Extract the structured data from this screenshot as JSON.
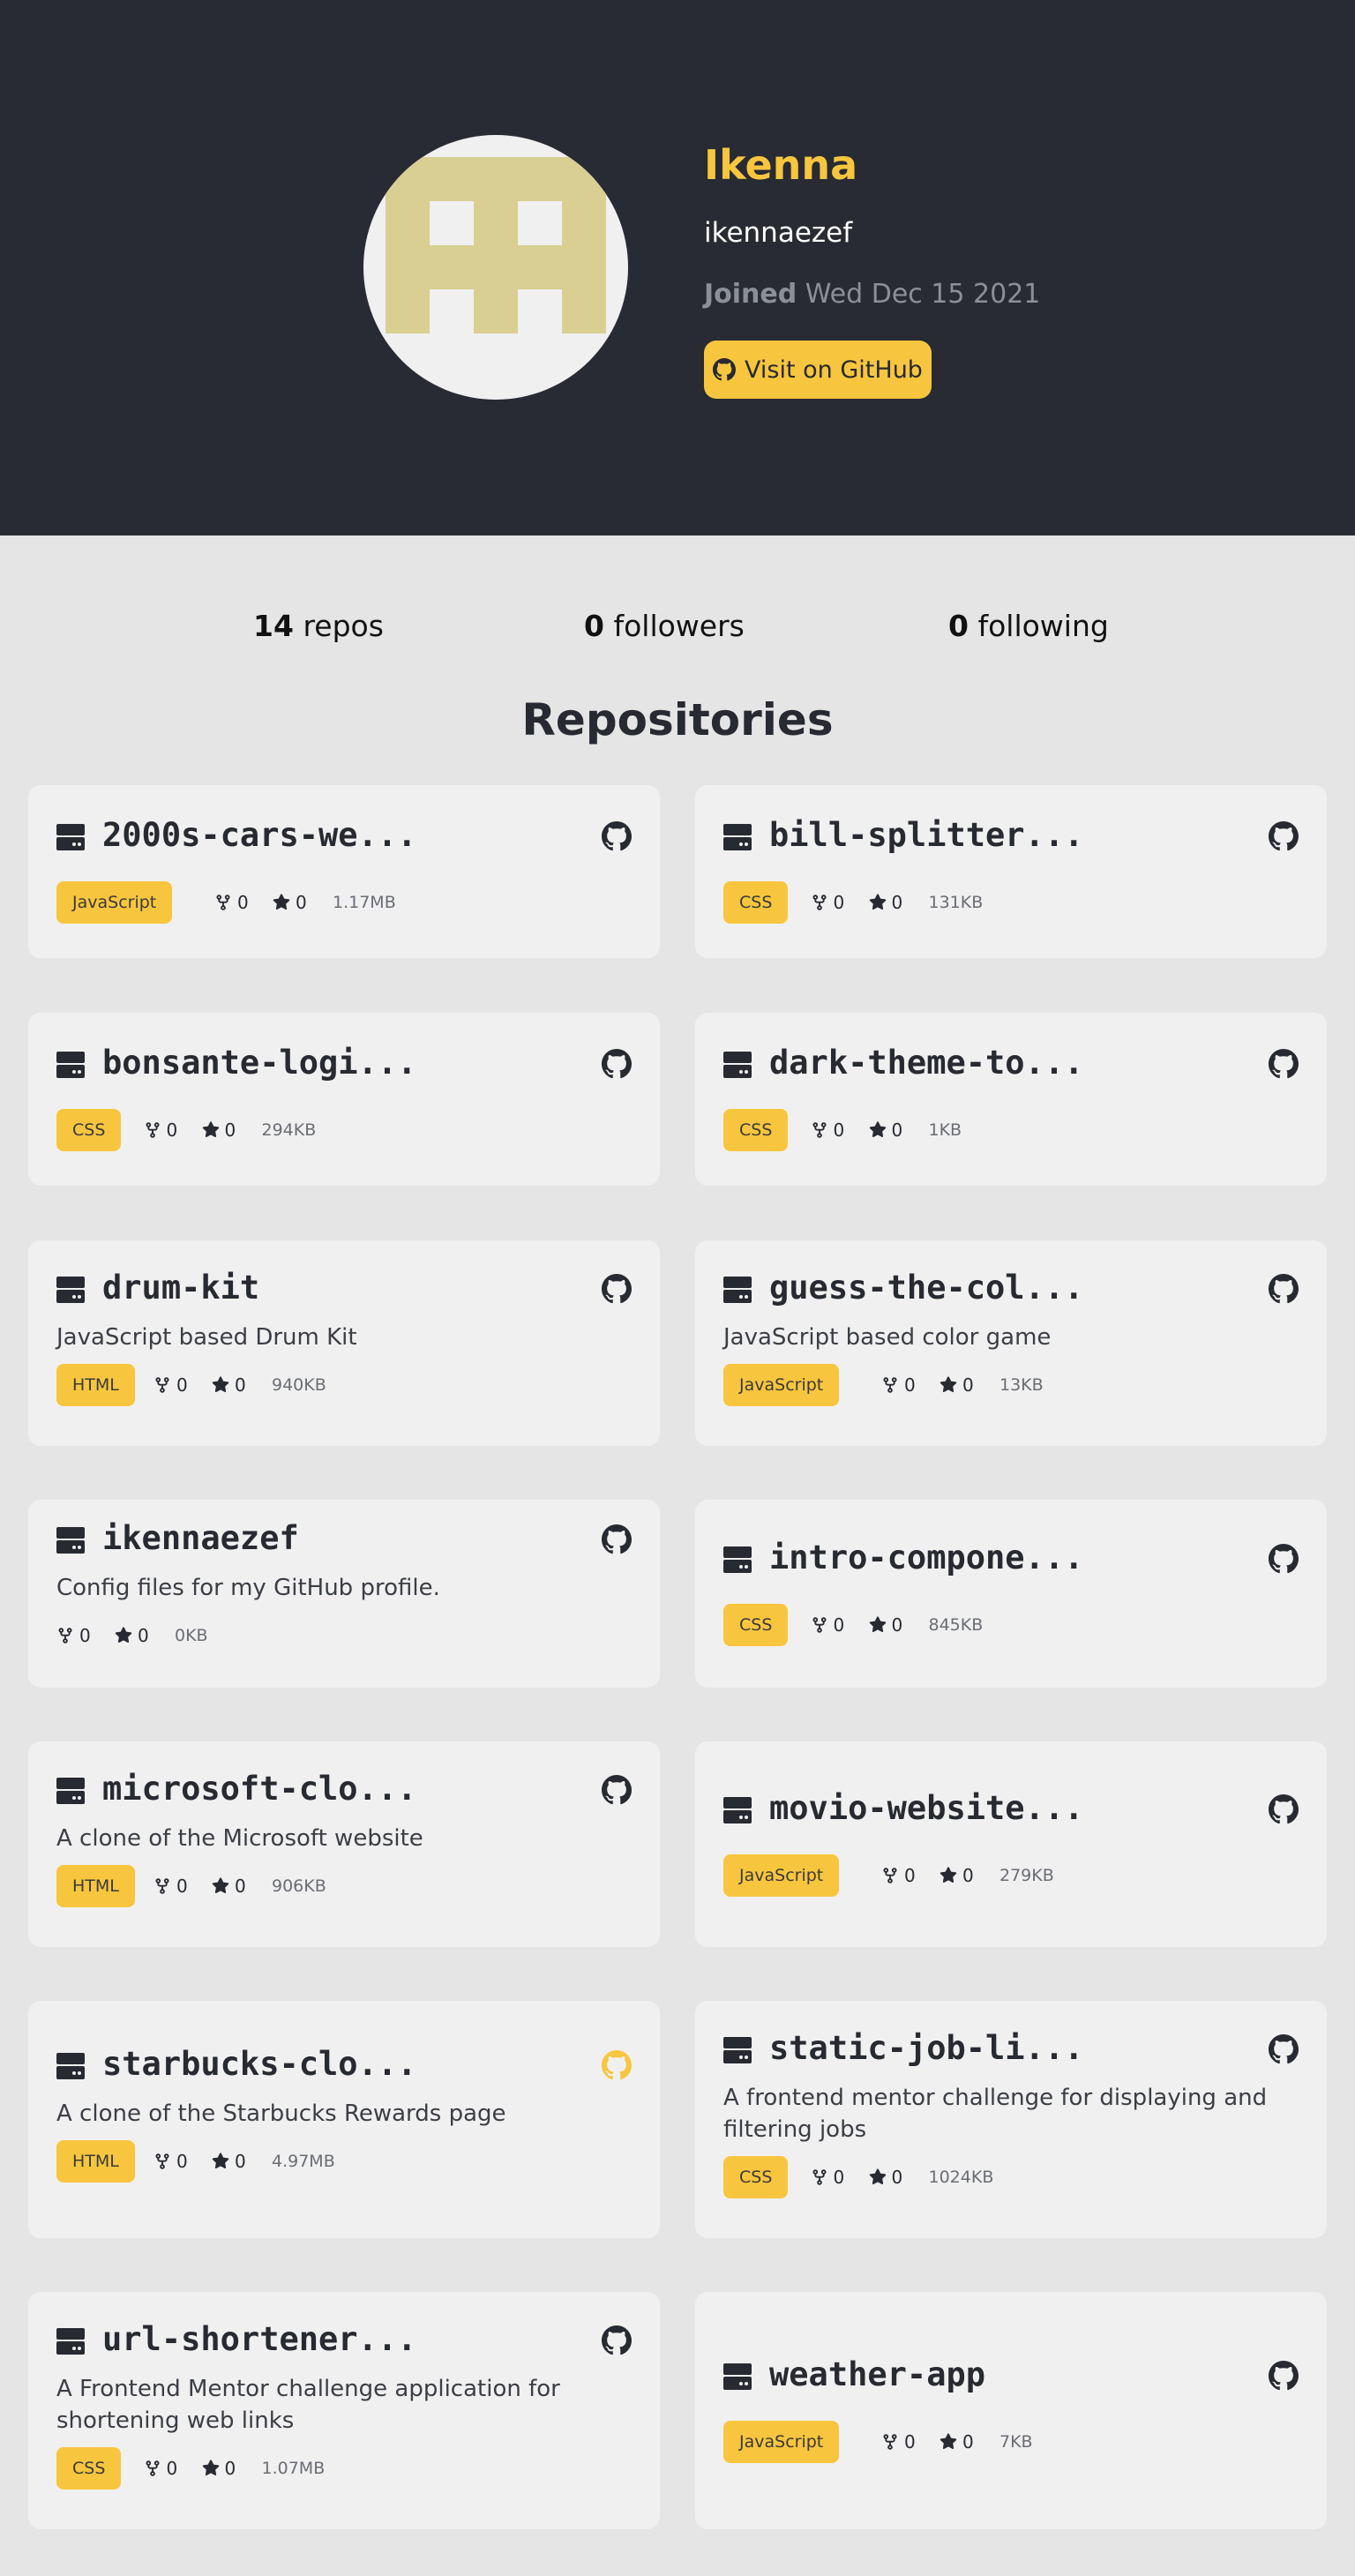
{
  "profile": {
    "name": "Ikenna",
    "login": "ikennaezef",
    "joined_label": "Joined",
    "joined_date": "Wed Dec 15 2021",
    "github_button_label": "Visit on GitHub",
    "avatar_color": "#d9cf92"
  },
  "stats": {
    "repos_count": "14",
    "repos_label": "repos",
    "followers_count": "0",
    "followers_label": "followers",
    "following_count": "0",
    "following_label": "following"
  },
  "section_title": "Repositories",
  "colors": {
    "accent": "#f8c53e",
    "hero_bg": "#282b33",
    "card_bg": "#f0f0f0",
    "page_bg": "#e5e5e5"
  },
  "repos": [
    {
      "name": "2000s-cars-we...",
      "description": "",
      "language": "JavaScript",
      "forks": "0",
      "stars": "0",
      "size": "1.17MB"
    },
    {
      "name": "bill-splitter...",
      "description": "",
      "language": "CSS",
      "forks": "0",
      "stars": "0",
      "size": "131KB"
    },
    {
      "name": "bonsante-logi...",
      "description": "",
      "language": "CSS",
      "forks": "0",
      "stars": "0",
      "size": "294KB"
    },
    {
      "name": "dark-theme-to...",
      "description": "",
      "language": "CSS",
      "forks": "0",
      "stars": "0",
      "size": "1KB"
    },
    {
      "name": "drum-kit",
      "description": "JavaScript based Drum Kit",
      "language": "HTML",
      "forks": "0",
      "stars": "0",
      "size": "940KB"
    },
    {
      "name": "guess-the-col...",
      "description": "JavaScript based color game",
      "language": "JavaScript",
      "forks": "0",
      "stars": "0",
      "size": "13KB"
    },
    {
      "name": "ikennaezef",
      "description": "Config files for my GitHub profile.",
      "language": "",
      "forks": "0",
      "stars": "0",
      "size": "0KB"
    },
    {
      "name": "intro-compone...",
      "description": "",
      "language": "CSS",
      "forks": "0",
      "stars": "0",
      "size": "845KB"
    },
    {
      "name": "microsoft-clo...",
      "description": "A clone of the Microsoft website",
      "language": "HTML",
      "forks": "0",
      "stars": "0",
      "size": "906KB"
    },
    {
      "name": "movio-website...",
      "description": "",
      "language": "JavaScript",
      "forks": "0",
      "stars": "0",
      "size": "279KB"
    },
    {
      "name": "starbucks-clo...",
      "description": "A clone of the Starbucks Rewards page",
      "language": "HTML",
      "forks": "0",
      "stars": "0",
      "size": "4.97MB",
      "highlight": true
    },
    {
      "name": "static-job-li...",
      "description": "A frontend mentor challenge for displaying and filtering jobs",
      "language": "CSS",
      "forks": "0",
      "stars": "0",
      "size": "1024KB"
    },
    {
      "name": "url-shortener...",
      "description": "A Frontend Mentor challenge application for shortening web links",
      "language": "CSS",
      "forks": "0",
      "stars": "0",
      "size": "1.07MB"
    },
    {
      "name": "weather-app",
      "description": "",
      "language": "JavaScript",
      "forks": "0",
      "stars": "0",
      "size": "7KB"
    }
  ]
}
